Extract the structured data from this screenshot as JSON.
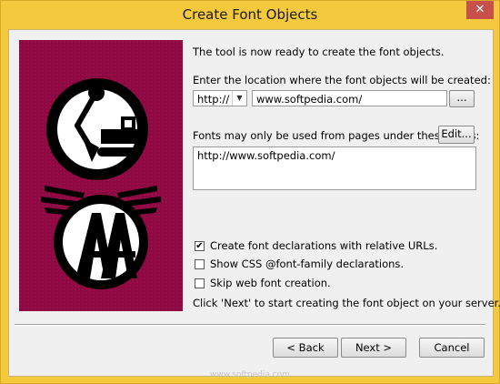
{
  "window": {
    "title": "Create Font Objects",
    "close_glyph": "✕"
  },
  "intro_text": "The tool is now ready to create the font objects.",
  "location": {
    "label": "Enter the location where the font objects will be created:",
    "protocol": "http://",
    "url": "www.softpedia.com/",
    "browse_label": "..."
  },
  "roots": {
    "label": "Fonts may only be used from pages under these roots:",
    "edit_label": "Edit...",
    "items": [
      "http://www.softpedia.com/"
    ]
  },
  "options": [
    {
      "label": "Create font declarations with relative URLs.",
      "checked": true
    },
    {
      "label": "Show CSS @font-family declarations.",
      "checked": false
    },
    {
      "label": "Skip web font creation.",
      "checked": false
    }
  ],
  "hint": "Click 'Next' to start creating the font object on your server.",
  "buttons": {
    "back": "< Back",
    "next": "Next >",
    "cancel": "Cancel"
  },
  "watermark": "www.softpedia.com",
  "colors": {
    "title_bar": "#f5c93e",
    "art_background": "#8e0842",
    "close_button": "#c7504b"
  }
}
